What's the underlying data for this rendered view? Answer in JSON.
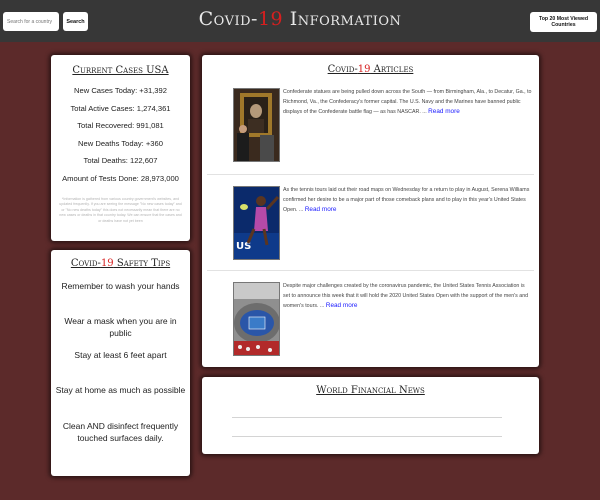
{
  "header": {
    "search_placeholder": "Search for a country",
    "search_button": "Search",
    "title_prefix": "Covid-",
    "title_number": "19",
    "title_suffix": " Information",
    "top20_button": "Top 20 Most Viewed Countries"
  },
  "cases": {
    "title": "Current Cases USA",
    "stats": [
      "New Cases Today: +31,392",
      "Total Active Cases: 1,274,361",
      "Total Recovered: 991,081",
      "New Deaths Today: +360",
      "Total Deaths: 122,607",
      "Amount of Tests Done: 28,973,000"
    ],
    "disclaimer": "*Information is gathered from various country government's websites, and updated frequently. If you are seeing the message \"No new cases today\" and or \"No new deaths today\" this does not necessarily mean that there are no new cases or deaths in that country today. We can ensure that the cases and or deaths have not yet been"
  },
  "tips": {
    "title_prefix": "Covid-",
    "title_number": "19",
    "title_suffix": " Safety Tips",
    "items": [
      "Remember to wash your hands",
      "Wear a mask when you are in public",
      "Stay at least 6 feet apart",
      "Stay at home as much as possible",
      "Clean AND disinfect frequently touched surfaces daily."
    ]
  },
  "articles": {
    "title_prefix": "Covid-",
    "title_number": "19",
    "title_suffix": " Articles",
    "read_more": "Read more",
    "items": [
      {
        "text": "Confederate statues are being pulled down across the South — from Birmingham, Ala., to Decatur, Ga., to Richmond, Va., the Confederacy's former capital. The U.S. Navy and the Marines have banned public displays of the Confederate battle flag — as has NASCAR. ...",
        "image": "painting-portrait"
      },
      {
        "text": "As the tennis tours laid out their road maps on Wednesday for a return to play in August, Serena Williams confirmed her desire to be a major part of those comeback plans and to play in this year's United States Open. ...",
        "image": "tennis-player"
      },
      {
        "text": "Despite major challenges created by the coronavirus pandemic, the United States Tennis Association is set to announce this week that it will hold the 2020 United States Open with the support of the men's and women's tours. ...",
        "image": "tennis-stadium"
      }
    ]
  },
  "news": {
    "title": "World Financial News"
  },
  "colors": {
    "background": "#5c2a2a",
    "header": "#373737",
    "accent_red": "#d61f1f",
    "link_blue": "#1a1aff"
  }
}
